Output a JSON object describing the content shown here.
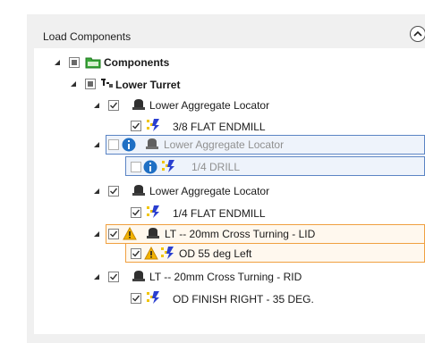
{
  "panel": {
    "title": "Load Components"
  },
  "tree": {
    "root": {
      "label": "Components"
    },
    "turret": {
      "label": "Lower Turret"
    },
    "items": [
      {
        "label": "Lower Aggregate Locator",
        "checked": true
      },
      {
        "label": "3/8 FLAT ENDMILL",
        "checked": true
      },
      {
        "label": "Lower Aggregate Locator",
        "checked": false,
        "status": "info"
      },
      {
        "label": "1/4 DRILL",
        "checked": false,
        "status": "info"
      },
      {
        "label": "Lower Aggregate Locator",
        "checked": true
      },
      {
        "label": "1/4 FLAT ENDMILL",
        "checked": true
      },
      {
        "label": "LT -- 20mm Cross Turning - LID",
        "checked": true,
        "status": "warning"
      },
      {
        "label": "OD 55 deg Left",
        "checked": true,
        "status": "warning"
      },
      {
        "label": "LT -- 20mm Cross Turning - RID",
        "checked": true
      },
      {
        "label": "OD FINISH RIGHT - 35 DEG.",
        "checked": true
      }
    ]
  },
  "colors": {
    "info_border": "#5b84c4",
    "warning_border": "#f0a040",
    "folder_green": "#3aa83a",
    "tool_yellow": "#f2c500",
    "tool_blue": "#2a3fd0"
  }
}
